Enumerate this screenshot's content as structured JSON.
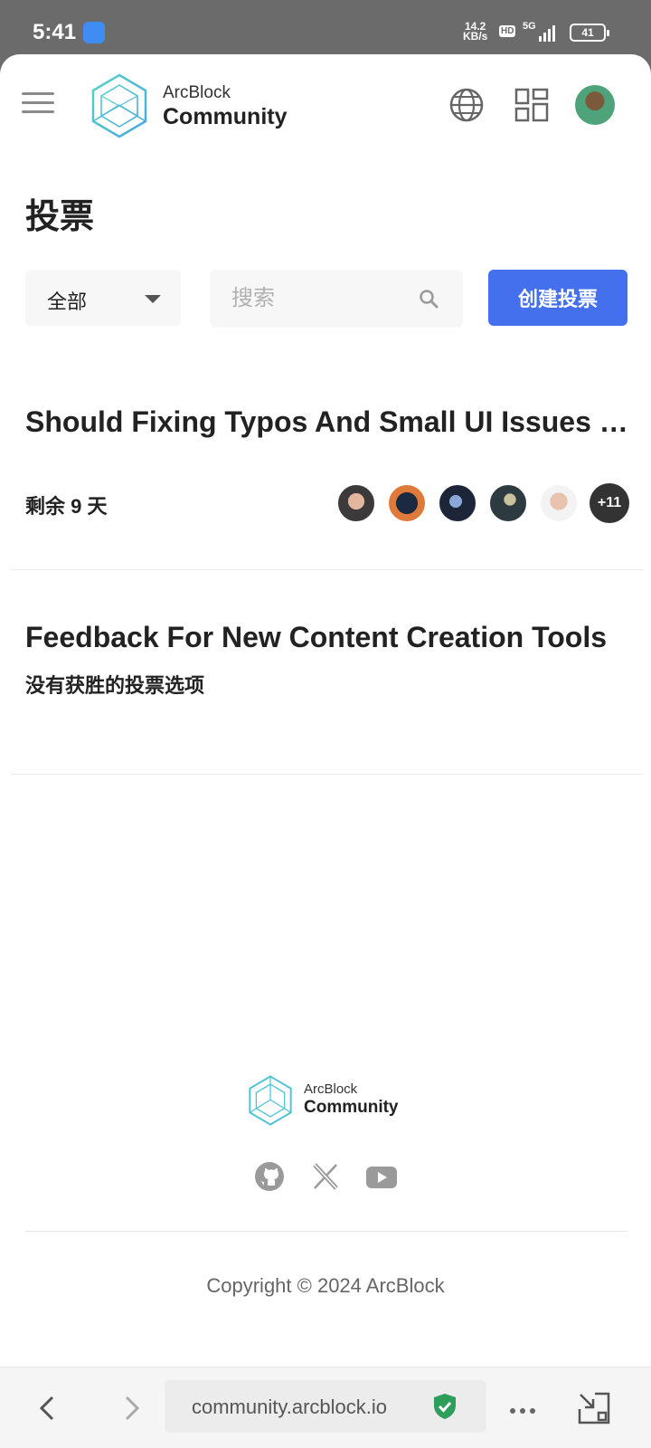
{
  "status_bar": {
    "time": "5:41",
    "net_speed_value": "14.2",
    "net_speed_unit": "KB/s",
    "hd_label": "HD",
    "network_label": "5G",
    "battery": "41"
  },
  "header": {
    "logo_line1": "ArcBlock",
    "logo_line2": "Community",
    "icons": [
      "menu-icon",
      "globe-icon",
      "apps-grid-icon",
      "avatar"
    ]
  },
  "page": {
    "title": "投票"
  },
  "filters": {
    "selected": "全部",
    "search_placeholder": "搜索",
    "search_value": "",
    "create_label": "创建投票"
  },
  "polls": [
    {
      "title": "Should Fixing Typos And Small UI Issues Get Rewards?",
      "remaining": "剩余 9 天",
      "voters_more": "+11"
    },
    {
      "title": "Feedback For New Content Creation Tools",
      "status": "没有获胜的投票选项"
    }
  ],
  "footer": {
    "logo_line1": "ArcBlock",
    "logo_line2": "Community",
    "social": [
      "github-icon",
      "x-icon",
      "youtube-icon"
    ],
    "copyright": "Copyright © 2024 ArcBlock"
  },
  "browser": {
    "url": "community.arcblock.io"
  },
  "colors": {
    "accent": "#4470EE",
    "logo_teal": "#4CC3D9",
    "shield_green": "#2E9E5B"
  }
}
